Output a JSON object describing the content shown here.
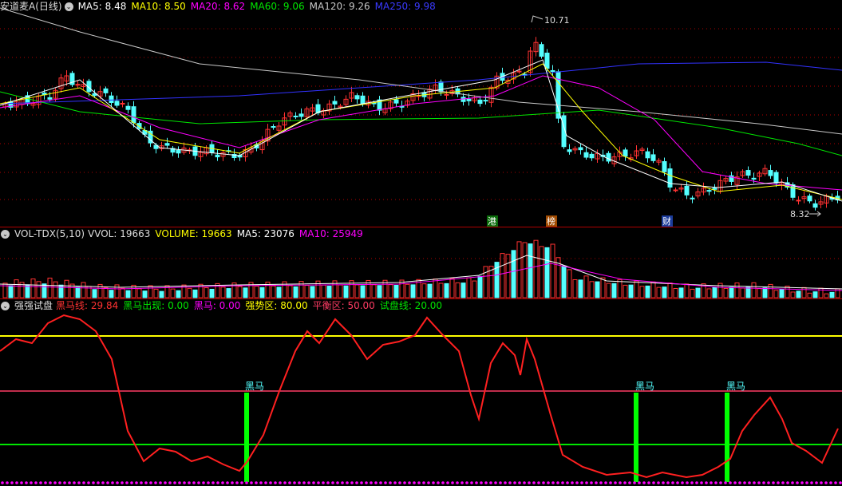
{
  "stock": {
    "title": "安道麦A(日线)",
    "ma5": "MA5: 8.48",
    "ma10": "MA10: 8.50",
    "ma20": "MA20: 8.62",
    "ma60": "MA60: 9.06",
    "ma120": "MA120: 9.26",
    "ma250": "MA250: 9.98",
    "high_label": "10.71",
    "low_label": "8.32",
    "markers": [
      "港",
      "榜",
      "财"
    ]
  },
  "volume": {
    "title": "VOL-TDX(5,10)",
    "vvol": "VVOL: 19663",
    "volume": "VOLUME: 19663",
    "ma5": "MA5: 23076",
    "ma10": "MA10: 25949"
  },
  "indicator": {
    "title": "强强试盘",
    "hm_line": "黑马线: 29.84",
    "hm_appear": "黑马出现: 0.00",
    "hm": "黑马: 0.00",
    "strong": "强势区: 80.00",
    "balance": "平衡区: 50.00",
    "test": "试盘线: 20.00",
    "signal_label": "黑马"
  },
  "colors": {
    "up": "#ff3232",
    "down": "#54ffff",
    "ma5": "#ffffff",
    "ma10": "#ffff00",
    "ma20": "#ff00ff",
    "ma60": "#00e600",
    "ma120": "#c8c8c8",
    "ma250": "#3232ff",
    "grid": "#b00000"
  }
}
